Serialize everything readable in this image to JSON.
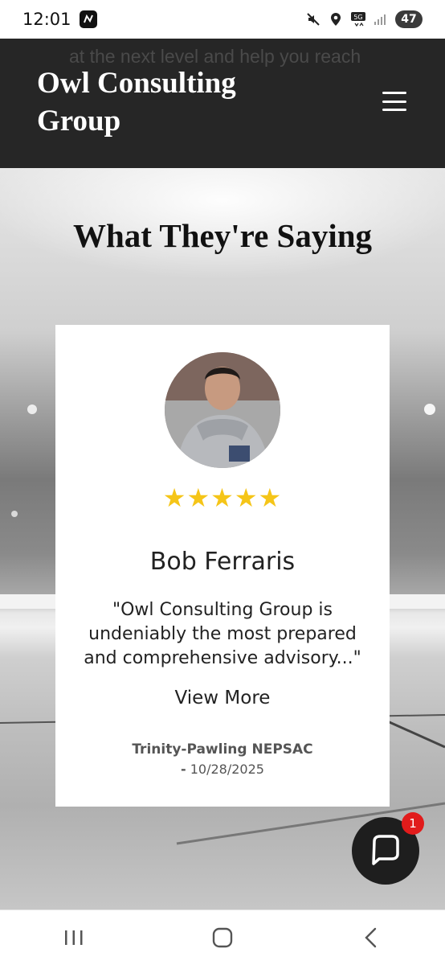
{
  "status_bar": {
    "time": "12:01",
    "battery": "47",
    "icons": [
      "mute-icon",
      "location-icon",
      "5g-icon",
      "signal-icon"
    ]
  },
  "header": {
    "title": "Owl Consulting Group",
    "ghost_text": "at the next level and help you reach"
  },
  "section": {
    "title": "What They're Saying"
  },
  "testimonial": {
    "rating": 5,
    "stars": "★★★★★",
    "name": "Bob Ferraris",
    "quote": "\"Owl Consulting Group is undeniably the most prepared and comprehensive advisory...\"",
    "view_more": "View More",
    "source": "Trinity-Pawling NEPSAC",
    "date_prefix": "-",
    "date": "10/28/2025"
  },
  "chat": {
    "badge_count": "1"
  },
  "colors": {
    "header_bg": "#262626",
    "star": "#f5c518",
    "badge": "#e11b1b"
  }
}
